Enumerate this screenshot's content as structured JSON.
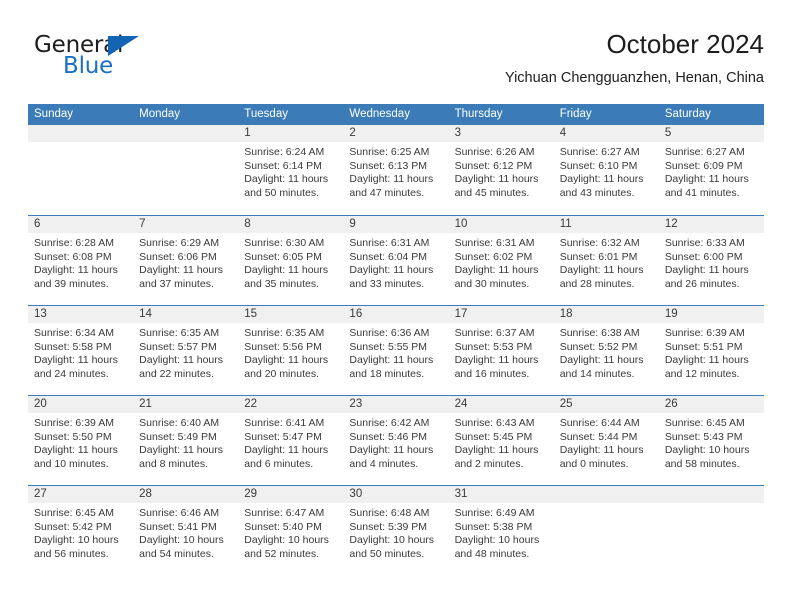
{
  "brand": {
    "name_part1": "General",
    "name_part2": "Blue",
    "triangle_color": "#1464b4",
    "blue_text_color": "#1a6fc4"
  },
  "header": {
    "title": "October 2024",
    "subtitle": "Yichuan Chengguanzhen, Henan, China"
  },
  "theme": {
    "header_blue": "#3b7cb8",
    "date_band_gray": "#f0f0f0",
    "text_color": "#3a3a3a"
  },
  "weekdays": [
    "Sunday",
    "Monday",
    "Tuesday",
    "Wednesday",
    "Thursday",
    "Friday",
    "Saturday"
  ],
  "weeks": [
    [
      {
        "num": "",
        "lines": []
      },
      {
        "num": "",
        "lines": []
      },
      {
        "num": "1",
        "lines": [
          "Sunrise: 6:24 AM",
          "Sunset: 6:14 PM",
          "Daylight: 11 hours",
          "and 50 minutes."
        ]
      },
      {
        "num": "2",
        "lines": [
          "Sunrise: 6:25 AM",
          "Sunset: 6:13 PM",
          "Daylight: 11 hours",
          "and 47 minutes."
        ]
      },
      {
        "num": "3",
        "lines": [
          "Sunrise: 6:26 AM",
          "Sunset: 6:12 PM",
          "Daylight: 11 hours",
          "and 45 minutes."
        ]
      },
      {
        "num": "4",
        "lines": [
          "Sunrise: 6:27 AM",
          "Sunset: 6:10 PM",
          "Daylight: 11 hours",
          "and 43 minutes."
        ]
      },
      {
        "num": "5",
        "lines": [
          "Sunrise: 6:27 AM",
          "Sunset: 6:09 PM",
          "Daylight: 11 hours",
          "and 41 minutes."
        ]
      }
    ],
    [
      {
        "num": "6",
        "lines": [
          "Sunrise: 6:28 AM",
          "Sunset: 6:08 PM",
          "Daylight: 11 hours",
          "and 39 minutes."
        ]
      },
      {
        "num": "7",
        "lines": [
          "Sunrise: 6:29 AM",
          "Sunset: 6:06 PM",
          "Daylight: 11 hours",
          "and 37 minutes."
        ]
      },
      {
        "num": "8",
        "lines": [
          "Sunrise: 6:30 AM",
          "Sunset: 6:05 PM",
          "Daylight: 11 hours",
          "and 35 minutes."
        ]
      },
      {
        "num": "9",
        "lines": [
          "Sunrise: 6:31 AM",
          "Sunset: 6:04 PM",
          "Daylight: 11 hours",
          "and 33 minutes."
        ]
      },
      {
        "num": "10",
        "lines": [
          "Sunrise: 6:31 AM",
          "Sunset: 6:02 PM",
          "Daylight: 11 hours",
          "and 30 minutes."
        ]
      },
      {
        "num": "11",
        "lines": [
          "Sunrise: 6:32 AM",
          "Sunset: 6:01 PM",
          "Daylight: 11 hours",
          "and 28 minutes."
        ]
      },
      {
        "num": "12",
        "lines": [
          "Sunrise: 6:33 AM",
          "Sunset: 6:00 PM",
          "Daylight: 11 hours",
          "and 26 minutes."
        ]
      }
    ],
    [
      {
        "num": "13",
        "lines": [
          "Sunrise: 6:34 AM",
          "Sunset: 5:58 PM",
          "Daylight: 11 hours",
          "and 24 minutes."
        ]
      },
      {
        "num": "14",
        "lines": [
          "Sunrise: 6:35 AM",
          "Sunset: 5:57 PM",
          "Daylight: 11 hours",
          "and 22 minutes."
        ]
      },
      {
        "num": "15",
        "lines": [
          "Sunrise: 6:35 AM",
          "Sunset: 5:56 PM",
          "Daylight: 11 hours",
          "and 20 minutes."
        ]
      },
      {
        "num": "16",
        "lines": [
          "Sunrise: 6:36 AM",
          "Sunset: 5:55 PM",
          "Daylight: 11 hours",
          "and 18 minutes."
        ]
      },
      {
        "num": "17",
        "lines": [
          "Sunrise: 6:37 AM",
          "Sunset: 5:53 PM",
          "Daylight: 11 hours",
          "and 16 minutes."
        ]
      },
      {
        "num": "18",
        "lines": [
          "Sunrise: 6:38 AM",
          "Sunset: 5:52 PM",
          "Daylight: 11 hours",
          "and 14 minutes."
        ]
      },
      {
        "num": "19",
        "lines": [
          "Sunrise: 6:39 AM",
          "Sunset: 5:51 PM",
          "Daylight: 11 hours",
          "and 12 minutes."
        ]
      }
    ],
    [
      {
        "num": "20",
        "lines": [
          "Sunrise: 6:39 AM",
          "Sunset: 5:50 PM",
          "Daylight: 11 hours",
          "and 10 minutes."
        ]
      },
      {
        "num": "21",
        "lines": [
          "Sunrise: 6:40 AM",
          "Sunset: 5:49 PM",
          "Daylight: 11 hours",
          "and 8 minutes."
        ]
      },
      {
        "num": "22",
        "lines": [
          "Sunrise: 6:41 AM",
          "Sunset: 5:47 PM",
          "Daylight: 11 hours",
          "and 6 minutes."
        ]
      },
      {
        "num": "23",
        "lines": [
          "Sunrise: 6:42 AM",
          "Sunset: 5:46 PM",
          "Daylight: 11 hours",
          "and 4 minutes."
        ]
      },
      {
        "num": "24",
        "lines": [
          "Sunrise: 6:43 AM",
          "Sunset: 5:45 PM",
          "Daylight: 11 hours",
          "and 2 minutes."
        ]
      },
      {
        "num": "25",
        "lines": [
          "Sunrise: 6:44 AM",
          "Sunset: 5:44 PM",
          "Daylight: 11 hours",
          "and 0 minutes."
        ]
      },
      {
        "num": "26",
        "lines": [
          "Sunrise: 6:45 AM",
          "Sunset: 5:43 PM",
          "Daylight: 10 hours",
          "and 58 minutes."
        ]
      }
    ],
    [
      {
        "num": "27",
        "lines": [
          "Sunrise: 6:45 AM",
          "Sunset: 5:42 PM",
          "Daylight: 10 hours",
          "and 56 minutes."
        ]
      },
      {
        "num": "28",
        "lines": [
          "Sunrise: 6:46 AM",
          "Sunset: 5:41 PM",
          "Daylight: 10 hours",
          "and 54 minutes."
        ]
      },
      {
        "num": "29",
        "lines": [
          "Sunrise: 6:47 AM",
          "Sunset: 5:40 PM",
          "Daylight: 10 hours",
          "and 52 minutes."
        ]
      },
      {
        "num": "30",
        "lines": [
          "Sunrise: 6:48 AM",
          "Sunset: 5:39 PM",
          "Daylight: 10 hours",
          "and 50 minutes."
        ]
      },
      {
        "num": "31",
        "lines": [
          "Sunrise: 6:49 AM",
          "Sunset: 5:38 PM",
          "Daylight: 10 hours",
          "and 48 minutes."
        ]
      },
      {
        "num": "",
        "lines": []
      },
      {
        "num": "",
        "lines": []
      }
    ]
  ]
}
